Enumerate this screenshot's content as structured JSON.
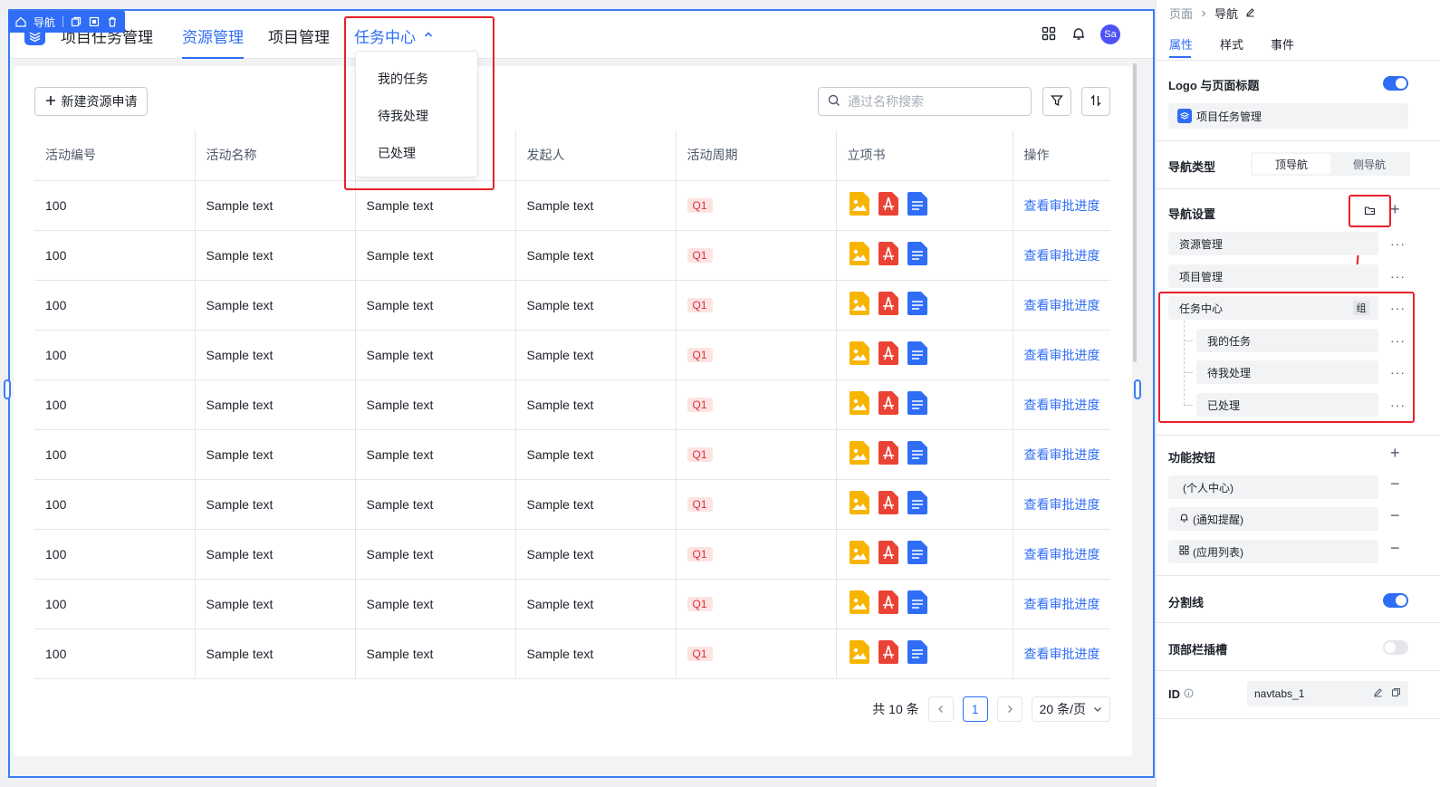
{
  "toolbar_tag": {
    "label": "导航"
  },
  "nav": {
    "title": "项目任务管理",
    "tabs": [
      {
        "label": "资源管理"
      },
      {
        "label": "项目管理"
      },
      {
        "label": "任务中心"
      }
    ],
    "dropdown": [
      "我的任务",
      "待我处理",
      "已处理"
    ],
    "avatar": "Sa"
  },
  "main": {
    "new_button": "新建资源申请",
    "search_placeholder": "通过名称搜索",
    "columns": [
      "活动编号",
      "活动名称",
      "",
      "发起人",
      "活动周期",
      "立项书",
      "操作"
    ],
    "rows": [
      {
        "id": "100",
        "name": "Sample text",
        "c3": "Sample text",
        "owner": "Sample text",
        "period": "Q1",
        "action": "查看审批进度"
      },
      {
        "id": "100",
        "name": "Sample text",
        "c3": "Sample text",
        "owner": "Sample text",
        "period": "Q1",
        "action": "查看审批进度"
      },
      {
        "id": "100",
        "name": "Sample text",
        "c3": "Sample text",
        "owner": "Sample text",
        "period": "Q1",
        "action": "查看审批进度"
      },
      {
        "id": "100",
        "name": "Sample text",
        "c3": "Sample text",
        "owner": "Sample text",
        "period": "Q1",
        "action": "查看审批进度"
      },
      {
        "id": "100",
        "name": "Sample text",
        "c3": "Sample text",
        "owner": "Sample text",
        "period": "Q1",
        "action": "查看审批进度"
      },
      {
        "id": "100",
        "name": "Sample text",
        "c3": "Sample text",
        "owner": "Sample text",
        "period": "Q1",
        "action": "查看审批进度"
      },
      {
        "id": "100",
        "name": "Sample text",
        "c3": "Sample text",
        "owner": "Sample text",
        "period": "Q1",
        "action": "查看审批进度"
      },
      {
        "id": "100",
        "name": "Sample text",
        "c3": "Sample text",
        "owner": "Sample text",
        "period": "Q1",
        "action": "查看审批进度"
      },
      {
        "id": "100",
        "name": "Sample text",
        "c3": "Sample text",
        "owner": "Sample text",
        "period": "Q1",
        "action": "查看审批进度"
      },
      {
        "id": "100",
        "name": "Sample text",
        "c3": "Sample text",
        "owner": "Sample text",
        "period": "Q1",
        "action": "查看审批进度"
      }
    ],
    "pager": {
      "total": "共 10 条",
      "page": "1",
      "size": "20 条/页"
    }
  },
  "panel": {
    "breadcrumb": [
      "页面",
      "导航"
    ],
    "tabs": [
      "属性",
      "样式",
      "事件"
    ],
    "logo_section": {
      "label": "Logo 与页面标题",
      "value": "项目任务管理",
      "enabled": true
    },
    "nav_type": {
      "label": "导航类型",
      "options": [
        "顶导航",
        "侧导航"
      ],
      "selected": "顶导航"
    },
    "nav_settings": {
      "label": "导航设置",
      "items": [
        "资源管理",
        "项目管理"
      ],
      "group": {
        "label": "任务中心",
        "badge": "组",
        "children": [
          "我的任务",
          "待我处理",
          "已处理"
        ]
      }
    },
    "func_buttons": {
      "label": "功能按钮",
      "items": [
        "(个人中心)",
        "(通知提醒)",
        "(应用列表)"
      ]
    },
    "divider": {
      "label": "分割线",
      "enabled": true
    },
    "slot": {
      "label": "顶部栏插槽",
      "enabled": false
    },
    "id_field": {
      "label": "ID",
      "value": "navtabs_1"
    }
  },
  "colors": {
    "accent": "#2f6df6",
    "highlight": "#e8202a",
    "badge_bg": "#fde3e2",
    "badge_text": "#d9303a"
  }
}
